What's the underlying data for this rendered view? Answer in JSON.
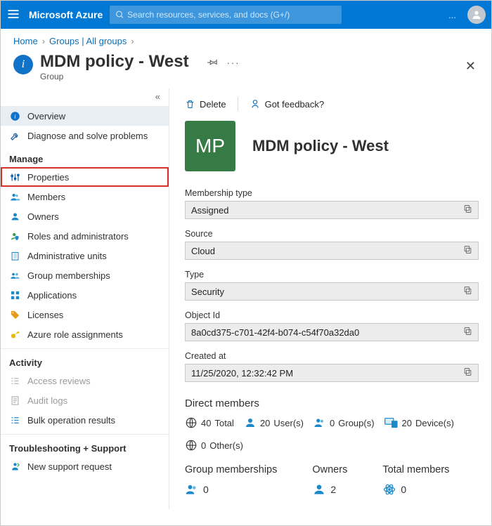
{
  "topbar": {
    "brand": "Microsoft Azure",
    "search_placeholder": "Search resources, services, and docs (G+/)",
    "more_label": "..."
  },
  "breadcrumb": {
    "items": [
      "Home",
      "Groups | All groups"
    ]
  },
  "page": {
    "title": "MDM policy - West",
    "subtitle": "Group"
  },
  "sidebar": {
    "items": [
      {
        "label": "Overview"
      },
      {
        "label": "Diagnose and solve problems"
      }
    ],
    "manage_header": "Manage",
    "manage": [
      {
        "label": "Properties"
      },
      {
        "label": "Members"
      },
      {
        "label": "Owners"
      },
      {
        "label": "Roles and administrators"
      },
      {
        "label": "Administrative units"
      },
      {
        "label": "Group memberships"
      },
      {
        "label": "Applications"
      },
      {
        "label": "Licenses"
      },
      {
        "label": "Azure role assignments"
      }
    ],
    "activity_header": "Activity",
    "activity": [
      {
        "label": "Access reviews"
      },
      {
        "label": "Audit logs"
      },
      {
        "label": "Bulk operation results"
      }
    ],
    "support_header": "Troubleshooting + Support",
    "support": [
      {
        "label": "New support request"
      }
    ]
  },
  "commands": {
    "delete": "Delete",
    "feedback": "Got feedback?"
  },
  "group": {
    "initials": "MP",
    "name": "MDM policy - West"
  },
  "fields": {
    "membership_type": {
      "label": "Membership type",
      "value": "Assigned"
    },
    "source": {
      "label": "Source",
      "value": "Cloud"
    },
    "type": {
      "label": "Type",
      "value": "Security"
    },
    "object_id": {
      "label": "Object Id",
      "value": "8a0cd375-c701-42f4-b074-c54f70a32da0"
    },
    "created_at": {
      "label": "Created at",
      "value": "11/25/2020, 12:32:42 PM"
    }
  },
  "direct_members": {
    "header": "Direct members",
    "total": {
      "value": "40",
      "label": " Total"
    },
    "users": {
      "value": "20",
      "label": " User(s)"
    },
    "groups": {
      "value": "0",
      "label": " Group(s)"
    },
    "devices": {
      "value": "20",
      "label": " Device(s)"
    },
    "other": {
      "value": "0",
      "label": " Other(s)"
    }
  },
  "summaries": {
    "memberships": {
      "label": "Group memberships",
      "value": "0"
    },
    "owners": {
      "label": "Owners",
      "value": "2"
    },
    "totalmem": {
      "label": "Total members",
      "value": "0"
    }
  }
}
